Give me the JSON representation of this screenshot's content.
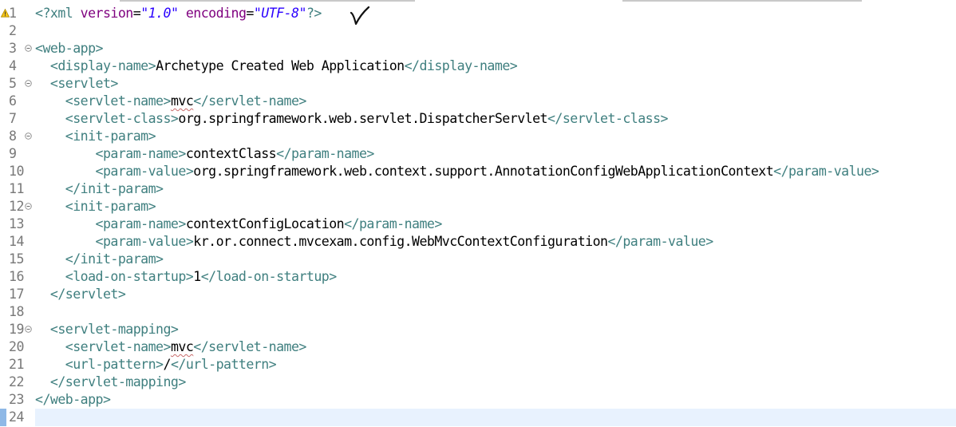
{
  "editor": {
    "file_type": "xml",
    "warning_line": 1,
    "current_line": 24,
    "lines": [
      {
        "num": "1",
        "fold": false,
        "segments": [
          {
            "t": "<?xml ",
            "c": "pi"
          },
          {
            "t": "version",
            "c": "attr"
          },
          {
            "t": "=",
            "c": "txt"
          },
          {
            "t": "\"1.0\"",
            "c": "val"
          },
          {
            "t": " ",
            "c": "txt"
          },
          {
            "t": "encoding",
            "c": "attr"
          },
          {
            "t": "=",
            "c": "txt"
          },
          {
            "t": "\"UTF-8\"",
            "c": "val"
          },
          {
            "t": "?>",
            "c": "pi"
          }
        ]
      },
      {
        "num": "2",
        "fold": false,
        "segments": []
      },
      {
        "num": "3",
        "fold": true,
        "segments": [
          {
            "t": "<web-app>",
            "c": "tag"
          }
        ]
      },
      {
        "num": "4",
        "fold": false,
        "segments": [
          {
            "t": "  ",
            "c": "txt"
          },
          {
            "t": "<display-name>",
            "c": "tag"
          },
          {
            "t": "Archetype Created Web Application",
            "c": "txt"
          },
          {
            "t": "</display-name>",
            "c": "tag"
          }
        ]
      },
      {
        "num": "5",
        "fold": true,
        "segments": [
          {
            "t": "  ",
            "c": "txt"
          },
          {
            "t": "<servlet>",
            "c": "tag"
          }
        ]
      },
      {
        "num": "6",
        "fold": false,
        "segments": [
          {
            "t": "    ",
            "c": "txt"
          },
          {
            "t": "<servlet-name>",
            "c": "tag"
          },
          {
            "t": "mvc",
            "c": "txt squiggle"
          },
          {
            "t": "</servlet-name>",
            "c": "tag"
          }
        ]
      },
      {
        "num": "7",
        "fold": false,
        "segments": [
          {
            "t": "    ",
            "c": "txt"
          },
          {
            "t": "<servlet-class>",
            "c": "tag"
          },
          {
            "t": "org.springframework.web.servlet.DispatcherServlet",
            "c": "txt"
          },
          {
            "t": "</servlet-class>",
            "c": "tag"
          }
        ]
      },
      {
        "num": "8",
        "fold": true,
        "segments": [
          {
            "t": "    ",
            "c": "txt"
          },
          {
            "t": "<init-param>",
            "c": "tag"
          }
        ]
      },
      {
        "num": "9",
        "fold": false,
        "segments": [
          {
            "t": "        ",
            "c": "txt"
          },
          {
            "t": "<param-name>",
            "c": "tag"
          },
          {
            "t": "contextClass",
            "c": "txt"
          },
          {
            "t": "</param-name>",
            "c": "tag"
          }
        ]
      },
      {
        "num": "10",
        "fold": false,
        "segments": [
          {
            "t": "        ",
            "c": "txt"
          },
          {
            "t": "<param-value>",
            "c": "tag"
          },
          {
            "t": "org.springframework.web.context.support.AnnotationConfigWebApplicationContext",
            "c": "txt"
          },
          {
            "t": "</param-value>",
            "c": "tag"
          }
        ]
      },
      {
        "num": "11",
        "fold": false,
        "segments": [
          {
            "t": "    ",
            "c": "txt"
          },
          {
            "t": "</init-param>",
            "c": "tag"
          }
        ]
      },
      {
        "num": "12",
        "fold": true,
        "segments": [
          {
            "t": "    ",
            "c": "txt"
          },
          {
            "t": "<init-param>",
            "c": "tag"
          }
        ]
      },
      {
        "num": "13",
        "fold": false,
        "segments": [
          {
            "t": "        ",
            "c": "txt"
          },
          {
            "t": "<param-name>",
            "c": "tag"
          },
          {
            "t": "contextConfigLocation",
            "c": "txt"
          },
          {
            "t": "</param-name>",
            "c": "tag"
          }
        ]
      },
      {
        "num": "14",
        "fold": false,
        "segments": [
          {
            "t": "        ",
            "c": "txt"
          },
          {
            "t": "<param-value>",
            "c": "tag"
          },
          {
            "t": "kr.or.connect.mvcexam.config.WebMvcContextConfiguration",
            "c": "txt"
          },
          {
            "t": "</param-value>",
            "c": "tag"
          }
        ]
      },
      {
        "num": "15",
        "fold": false,
        "segments": [
          {
            "t": "    ",
            "c": "txt"
          },
          {
            "t": "</init-param>",
            "c": "tag"
          }
        ]
      },
      {
        "num": "16",
        "fold": false,
        "segments": [
          {
            "t": "    ",
            "c": "txt"
          },
          {
            "t": "<load-on-startup>",
            "c": "tag"
          },
          {
            "t": "1",
            "c": "txt"
          },
          {
            "t": "</load-on-startup>",
            "c": "tag"
          }
        ]
      },
      {
        "num": "17",
        "fold": false,
        "segments": [
          {
            "t": "  ",
            "c": "txt"
          },
          {
            "t": "</servlet>",
            "c": "tag"
          }
        ]
      },
      {
        "num": "18",
        "fold": false,
        "segments": []
      },
      {
        "num": "19",
        "fold": true,
        "segments": [
          {
            "t": "  ",
            "c": "txt"
          },
          {
            "t": "<servlet-mapping>",
            "c": "tag"
          }
        ]
      },
      {
        "num": "20",
        "fold": false,
        "segments": [
          {
            "t": "    ",
            "c": "txt"
          },
          {
            "t": "<servlet-name>",
            "c": "tag"
          },
          {
            "t": "mvc",
            "c": "txt squiggle"
          },
          {
            "t": "</servlet-name>",
            "c": "tag"
          }
        ]
      },
      {
        "num": "21",
        "fold": false,
        "segments": [
          {
            "t": "    ",
            "c": "txt"
          },
          {
            "t": "<url-pattern>",
            "c": "tag"
          },
          {
            "t": "/",
            "c": "txt"
          },
          {
            "t": "</url-pattern>",
            "c": "tag"
          }
        ]
      },
      {
        "num": "22",
        "fold": false,
        "segments": [
          {
            "t": "  ",
            "c": "txt"
          },
          {
            "t": "</servlet-mapping>",
            "c": "tag"
          }
        ]
      },
      {
        "num": "23",
        "fold": false,
        "segments": [
          {
            "t": "</web-app>",
            "c": "tag"
          }
        ]
      },
      {
        "num": "24",
        "fold": false,
        "segments": []
      }
    ]
  },
  "colors": {
    "tag": "#3f7f7f",
    "attribute": "#7f007f",
    "attribute_value": "#2a00ff",
    "text": "#000000",
    "line_number": "#787878",
    "current_line_bg": "#e8f2fe",
    "warning": "#f5c518"
  },
  "icons": {
    "warning": "warning-icon",
    "fold": "fold-collapse-icon",
    "annotation": "handwritten-check-mark-icon"
  }
}
